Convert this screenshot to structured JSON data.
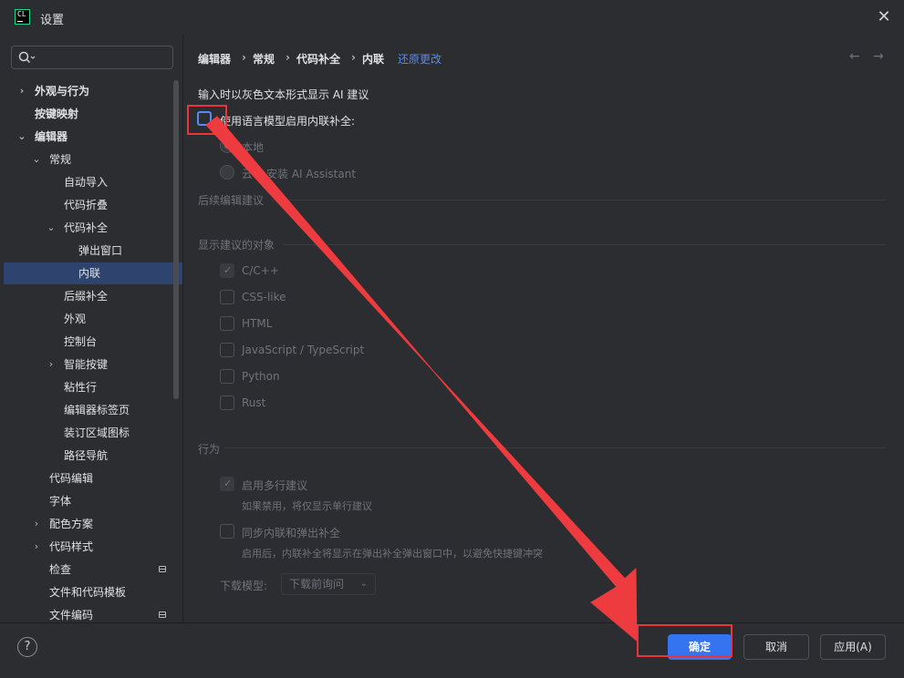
{
  "window": {
    "title": "设置",
    "app_logo_text": "CL"
  },
  "sidebar": {
    "search_placeholder": "",
    "items": [
      {
        "label": "外观与行为",
        "chevron": "›",
        "bold": true
      },
      {
        "label": "按键映射",
        "chevron": "",
        "bold": true
      },
      {
        "label": "编辑器",
        "chevron": "⌄",
        "bold": true
      },
      {
        "label": "常规",
        "chevron": "⌄"
      },
      {
        "label": "自动导入",
        "chevron": ""
      },
      {
        "label": "代码折叠",
        "chevron": ""
      },
      {
        "label": "代码补全",
        "chevron": "⌄"
      },
      {
        "label": "弹出窗口",
        "chevron": ""
      },
      {
        "label": "内联",
        "chevron": "",
        "selected": true
      },
      {
        "label": "后缀补全",
        "chevron": ""
      },
      {
        "label": "外观",
        "chevron": ""
      },
      {
        "label": "控制台",
        "chevron": ""
      },
      {
        "label": "智能按键",
        "chevron": "›"
      },
      {
        "label": "粘性行",
        "chevron": ""
      },
      {
        "label": "编辑器标签页",
        "chevron": ""
      },
      {
        "label": "装订区域图标",
        "chevron": ""
      },
      {
        "label": "路径导航",
        "chevron": ""
      },
      {
        "label": "代码编辑",
        "chevron": ""
      },
      {
        "label": "字体",
        "chevron": ""
      },
      {
        "label": "配色方案",
        "chevron": "›"
      },
      {
        "label": "代码样式",
        "chevron": "›"
      },
      {
        "label": "检查",
        "chevron": "",
        "badge": true
      },
      {
        "label": "文件和代码模板",
        "chevron": ""
      },
      {
        "label": "文件编码",
        "chevron": "",
        "badge": true
      }
    ]
  },
  "breadcrumb": {
    "items": [
      "编辑器",
      "常规",
      "代码补全",
      "内联"
    ],
    "separator": "›",
    "reset_link": "还原更改",
    "back_icon": "←",
    "forward_icon": "→"
  },
  "main": {
    "intro": "输入时以灰色文本形式显示 AI 建议",
    "enable_label": "使用语言模型启用内联补全:",
    "radio_local": "本地",
    "radio_cloud": "云",
    "install_ai": "安装 AI Assistant",
    "section_followup": "后续编辑建议",
    "section_targets": "显示建议的对象",
    "languages": [
      {
        "label": "C/C++",
        "checked": true
      },
      {
        "label": "CSS-like",
        "checked": false
      },
      {
        "label": "HTML",
        "checked": false
      },
      {
        "label": "JavaScript / TypeScript",
        "checked": false
      },
      {
        "label": "Python",
        "checked": false
      },
      {
        "label": "Rust",
        "checked": false
      }
    ],
    "section_behavior": "行为",
    "multiline_label": "启用多行建议",
    "multiline_hint": "如果禁用，将仅显示单行建议",
    "sync_label": "同步内联和弹出补全",
    "sync_hint": "启用后，内联补全将显示在弹出补全弹出窗口中，以避免快捷键冲突",
    "download_label": "下载模型:",
    "download_value": "下载前询问"
  },
  "footer": {
    "help_icon": "?",
    "ok": "确定",
    "cancel": "取消",
    "apply": "应用(A)"
  },
  "colors": {
    "background": "#2b2d30",
    "accent": "#3574f0",
    "link": "#548af7",
    "selection": "#2e436e",
    "annotation_red": "#e8353a"
  }
}
